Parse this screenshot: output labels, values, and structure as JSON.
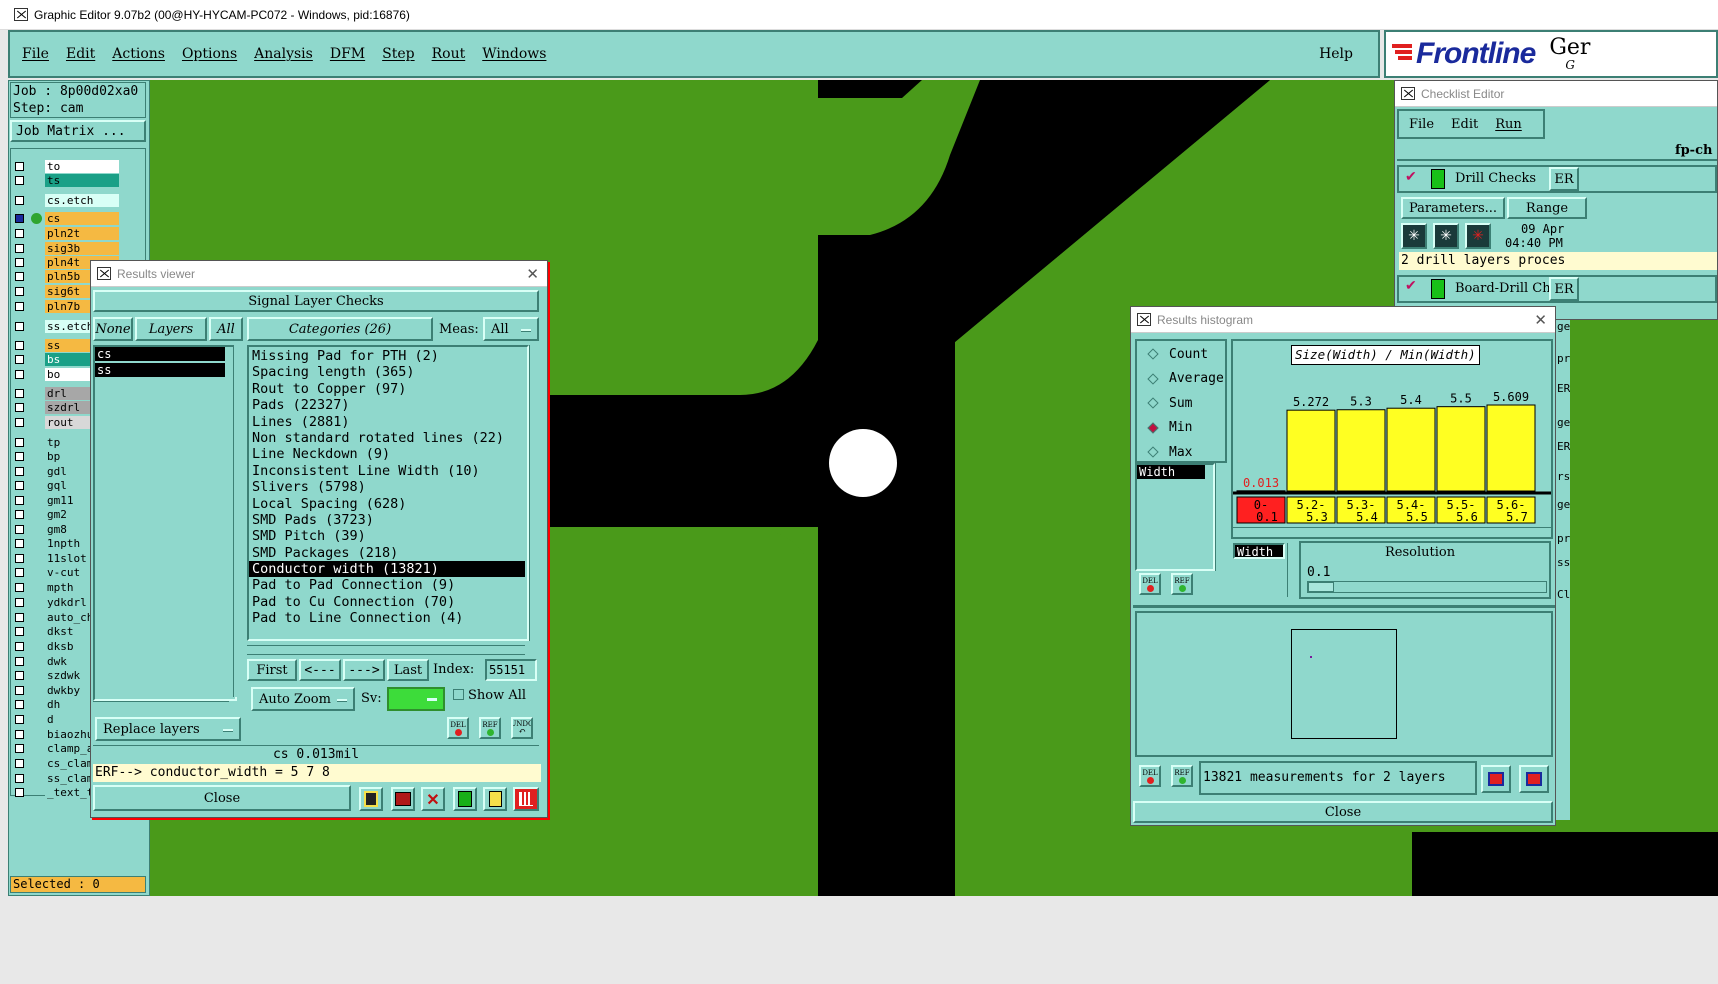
{
  "window_title": "Graphic Editor 9.07b2 (00@HY-HYCAM-PC072 - Windows, pid:16876)",
  "menu": [
    "File",
    "Edit",
    "Actions",
    "Options",
    "Analysis",
    "DFM",
    "Step",
    "Rout",
    "Windows"
  ],
  "help": "Help",
  "brand": {
    "logo": "Frontline",
    "logo_tail": "Ger",
    "logo_sub": "G"
  },
  "job": {
    "job": "Job : 8p00d02xa0",
    "step": "Step: cam",
    "matrix": "Job Matrix ..."
  },
  "layers": [
    {
      "name": "to",
      "color": "#ffffff"
    },
    {
      "name": "ts",
      "color": "#1aa087"
    },
    {
      "name": "cs.etch",
      "color": "#d8fff6"
    },
    {
      "name": "cs",
      "color": "#f5b942"
    },
    {
      "name": "pln2t",
      "color": "#f5b942"
    },
    {
      "name": "sig3b",
      "color": "#f5b942"
    },
    {
      "name": "pln4t",
      "color": "#f5b942"
    },
    {
      "name": "pln5b",
      "color": "#f5b942"
    },
    {
      "name": "sig6t",
      "color": "#f5b942"
    },
    {
      "name": "pln7b",
      "color": "#f5b942"
    },
    {
      "name": "ss.etch",
      "color": "#d8fff6"
    },
    {
      "name": "ss",
      "color": "#f5b942"
    },
    {
      "name": "bs",
      "color": "#1aa087"
    },
    {
      "name": "bo",
      "color": "#ffffff"
    },
    {
      "name": "drl",
      "color": "#a7a7a7"
    },
    {
      "name": "szdrl",
      "color": "#a7a7a7"
    },
    {
      "name": "rout",
      "color": "#d8d8d8"
    },
    {
      "name": "tp",
      "color": "#8fd8cc"
    },
    {
      "name": "bp",
      "color": "#8fd8cc"
    },
    {
      "name": "gdl",
      "color": "#8fd8cc"
    },
    {
      "name": "gql",
      "color": "#8fd8cc"
    },
    {
      "name": "gm11",
      "color": "#8fd8cc"
    },
    {
      "name": "gm2",
      "color": "#8fd8cc"
    },
    {
      "name": "gm8",
      "color": "#8fd8cc"
    },
    {
      "name": "1npth",
      "color": "#8fd8cc"
    },
    {
      "name": "11slot",
      "color": "#8fd8cc"
    },
    {
      "name": "v-cut",
      "color": "#8fd8cc"
    },
    {
      "name": "mpth",
      "color": "#8fd8cc"
    },
    {
      "name": "ydkdrl",
      "color": "#8fd8cc"
    },
    {
      "name": "auto_ch",
      "color": "#8fd8cc"
    },
    {
      "name": "dkst",
      "color": "#8fd8cc"
    },
    {
      "name": "dksb",
      "color": "#8fd8cc"
    },
    {
      "name": "dwk",
      "color": "#8fd8cc"
    },
    {
      "name": "szdwk",
      "color": "#8fd8cc"
    },
    {
      "name": "dwkby",
      "color": "#8fd8cc"
    },
    {
      "name": "dh",
      "color": "#8fd8cc"
    },
    {
      "name": "d",
      "color": "#8fd8cc"
    },
    {
      "name": "biaozhu",
      "color": "#8fd8cc"
    },
    {
      "name": "clamp_a",
      "color": "#8fd8cc"
    },
    {
      "name": "cs_clam",
      "color": "#8fd8cc"
    },
    {
      "name": "ss_clam",
      "color": "#8fd8cc"
    },
    {
      "name": "_text_t",
      "color": "#8fd8cc"
    }
  ],
  "selected": "Selected : 0",
  "results_viewer": {
    "title": "Results viewer",
    "heading": "Signal Layer Checks",
    "none": "None",
    "layers": "Layers",
    "all": "All",
    "categories_label": "Categories (26)",
    "meas_label": "Meas:",
    "meas_value": "All",
    "layer_list": [
      "cs",
      "ss"
    ],
    "categories": [
      "Missing Pad for PTH (2)",
      "Spacing length (365)",
      "Rout to Copper (97)",
      "Pads (22327)",
      "Lines (2881)",
      "Non standard rotated lines (22)",
      "Line Neckdown (9)",
      "Inconsistent Line Width (10)",
      "Slivers (5798)",
      "Local Spacing (628)",
      "SMD Pads (3723)",
      "SMD Pitch (39)",
      "SMD Packages (218)",
      "Conductor width (13821)",
      "Pad to Pad Connection (9)",
      "Pad to Cu Connection (70)",
      "Pad to Line Connection (4)"
    ],
    "selected_category": "Conductor width (13821)",
    "first": "First",
    "prev": "<---",
    "next": "--->",
    "last": "Last",
    "index_label": "Index:",
    "index_value": "55151",
    "auto_zoom": "Auto Zoom",
    "sv": "Sv:",
    "show_all": "Show All",
    "replace_layers": "Replace layers",
    "del": "DEL",
    "ref": "REF",
    "undo": "UNDO",
    "status": "cs 0.013mil",
    "erf": "ERF--> conductor_width = 5 7 8",
    "close": "Close"
  },
  "checklist_editor": {
    "title": "Checklist Editor",
    "menu": [
      "File",
      "Edit",
      "Run"
    ],
    "name": "fp-ch",
    "drill_checks": "Drill Checks",
    "er": "ER",
    "parameters": "Parameters...",
    "range": "Range",
    "date": "09 Apr",
    "time": "04:40 PM",
    "drill_info": "2 drill layers proces",
    "board_drill": "Board-Drill Che",
    "side_frags": [
      "ge",
      "pr",
      "ER",
      "ge",
      "ER",
      "rs",
      "ge",
      "pr",
      "ss",
      "Cl"
    ]
  },
  "histogram": {
    "title": "Results histogram",
    "modes": [
      "Count",
      "Average",
      "Sum",
      "Min",
      "Max"
    ],
    "selected_mode": "Min",
    "measure": "Width",
    "chart_title": "Size(Width) / Min(Width)",
    "resolution_label": "Resolution",
    "resolution_value": "0.1",
    "measure_small": "Width",
    "summary": "13821 measurements for 2 layers",
    "close": "Close",
    "del": "DEL",
    "ref": "REF"
  },
  "chart_data": {
    "type": "bar",
    "title": "Size(Width) / Min(Width)",
    "categories": [
      "0-0.1",
      "5.2-5.3",
      "5.3-5.4",
      "5.4-5.5",
      "5.5-5.6",
      "5.6-5.7"
    ],
    "values": [
      0.013,
      5.272,
      5.3,
      5.4,
      5.5,
      5.609
    ],
    "value_labels": [
      "0.013",
      "5.272",
      "5.3",
      "5.4",
      "5.5",
      "5.609"
    ],
    "colors": [
      "#ff2020",
      "#ffff22",
      "#ffff22",
      "#ffff22",
      "#ffff22",
      "#ffff22"
    ]
  }
}
